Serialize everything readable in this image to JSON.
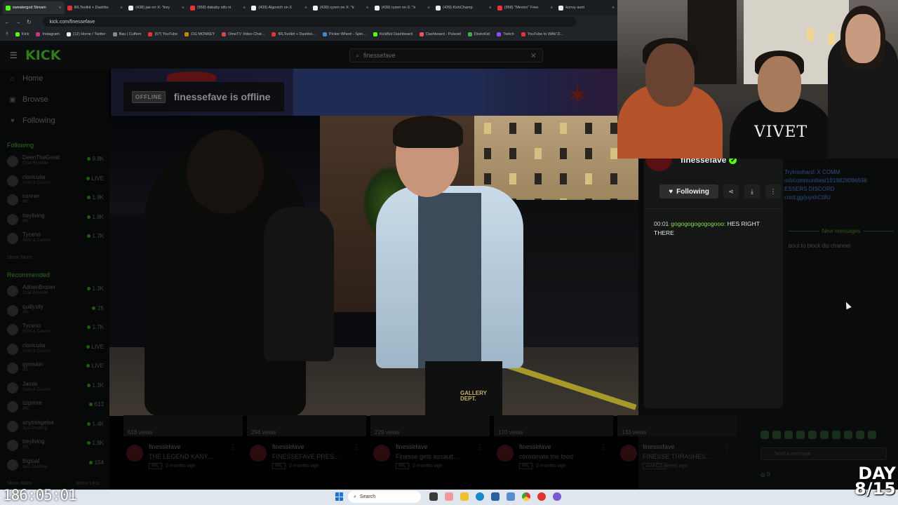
{
  "browser": {
    "tabs": [
      {
        "label": "sweatergod Stream",
        "color": "#53fc18",
        "active": true
      },
      {
        "label": "IRLToolkit + Dashbo",
        "color": "#d33"
      },
      {
        "label": "(438) jae on X: \"trey",
        "color": "#eee"
      },
      {
        "label": "(958) dababy stfu ni",
        "color": "#e33"
      },
      {
        "label": "(439) Algovich on X",
        "color": "#eee"
      },
      {
        "label": "(439) ryzen on X: \"tr",
        "color": "#eee"
      },
      {
        "label": "(439) ryzen on X: \"tr",
        "color": "#eee"
      },
      {
        "label": "(439) KickChamp",
        "color": "#eee"
      },
      {
        "label": "(958) \"Mexico\" Free",
        "color": "#e33"
      },
      {
        "label": "konvy aunt",
        "color": "#eee"
      }
    ],
    "url": "kick.com/finessefave",
    "bookmarks": [
      {
        "label": "Kick",
        "color": "#53fc18"
      },
      {
        "label": "Instagram",
        "color": "#c13584"
      },
      {
        "label": "(12) Home / Twitter",
        "color": "#eee"
      },
      {
        "label": "Bau | Cuffem",
        "color": "#888"
      },
      {
        "label": "(57) YouTube",
        "color": "#e33"
      },
      {
        "label": "OG MONKEY",
        "color": "#c80"
      },
      {
        "label": "OmeTV Video Chat...",
        "color": "#d44"
      },
      {
        "label": "IRLToolkit + Dashbo...",
        "color": "#d33"
      },
      {
        "label": "Picker Wheel - Spin...",
        "color": "#48c"
      },
      {
        "label": "KickBot Dashboard",
        "color": "#53fc18"
      },
      {
        "label": "Dashboard - Pulsoid",
        "color": "#e55"
      },
      {
        "label": "DistroKid",
        "color": "#4a4"
      },
      {
        "label": "Twitch",
        "color": "#9146ff"
      },
      {
        "label": "YouTube to WAV D...",
        "color": "#e33"
      }
    ]
  },
  "kick": {
    "logo": "KICK",
    "search_value": "finessefave",
    "nav": [
      {
        "label": "Home",
        "icon": "home-icon",
        "glyph": "⌂"
      },
      {
        "label": "Browse",
        "icon": "browse-icon",
        "glyph": "▣"
      },
      {
        "label": "Following",
        "icon": "heart-icon",
        "glyph": "♥"
      }
    ],
    "following_label": "Following",
    "following": [
      {
        "name": "DeenTheGreat",
        "category": "Chat Roulette",
        "viewers": "9.8K"
      },
      {
        "name": "clavicular",
        "category": "Slots & Casino",
        "viewers": "LIVE"
      },
      {
        "name": "conner",
        "category": "IRL",
        "viewers": "1.9K"
      },
      {
        "name": "treyliving",
        "category": "IRL",
        "viewers": "1.9K"
      },
      {
        "name": "Tyceno",
        "category": "Slots & Casino",
        "viewers": "1.7K"
      }
    ],
    "show_more": "Show More",
    "recommended_label": "Recommended",
    "recommended": [
      {
        "name": "AdrienBroner",
        "category": "Chat Roulette",
        "viewers": "1.3K"
      },
      {
        "name": "quillyslly",
        "category": "IRL",
        "viewers": "25"
      },
      {
        "name": "Tyceno",
        "category": "Slots & Casino",
        "viewers": "1.7K"
      },
      {
        "name": "clavicular",
        "category": "Slots & Casino",
        "viewers": "LIVE"
      },
      {
        "name": "gymskin",
        "category": "IRL",
        "viewers": "LIVE"
      },
      {
        "name": "Jamie",
        "category": "Slots & Casino",
        "viewers": "1.3K"
      },
      {
        "name": "Iziprime",
        "category": "IRL",
        "viewers": "613"
      },
      {
        "name": "anythingelse",
        "category": "Just Chatting",
        "viewers": "1.4K"
      },
      {
        "name": "treyliving",
        "category": "IRL",
        "viewers": "1.9K"
      },
      {
        "name": "Bigloaf",
        "category": "Just Chatting",
        "viewers": "154"
      }
    ],
    "show_more_bottom": "Show More",
    "show_less": "Show Less",
    "offline_pill": "OFFLINE",
    "offline_text": "finessefave is offline"
  },
  "video": {
    "pants_text": "GALLERY DEPT."
  },
  "channel": {
    "name": "finessefave",
    "follow_label": "Following",
    "chat": [
      {
        "time": "00:01",
        "user": "gogogogogogogooo:",
        "text": "HES RIGHT THERE"
      }
    ],
    "dim_chat": [
      "Trylnsohard: X COMM",
      "m/i/communities/1919828096598",
      "ESSERS DISCORD",
      "cord.gg/juyxhCt8U"
    ],
    "new_messages": "New messages",
    "dim_line": "bout to block dis channel",
    "send_placeholder": "Send a message",
    "points": "0"
  },
  "clips": [
    {
      "views": "618 views",
      "channel": "finessefave",
      "title": "THE LEGEND KANY...",
      "tag": "IRL",
      "ago": "2 months ago"
    },
    {
      "views": "294 views",
      "channel": "finessefave",
      "title": "FINESSEFAVE PRES...",
      "tag": "IRL",
      "ago": "2 months ago"
    },
    {
      "views": "229 views",
      "channel": "finessefave",
      "title": "Finesse gets assault...",
      "tag": "IRL",
      "ago": "2 months ago"
    },
    {
      "views": "170 views",
      "channel": "finessefave",
      "title": "coordinate the food",
      "tag": "IRL",
      "ago": "2 months ago"
    },
    {
      "views": "133 views",
      "channel": "finessefave",
      "title": "FINESSE THRASHES...",
      "tag": "Just C...",
      "ago": "3 weeks ago"
    }
  ],
  "overlay": {
    "timer": "186:05:01",
    "day_label": "DAY",
    "day_count": "8/15"
  },
  "taskbar": {
    "search_label": "Search"
  }
}
